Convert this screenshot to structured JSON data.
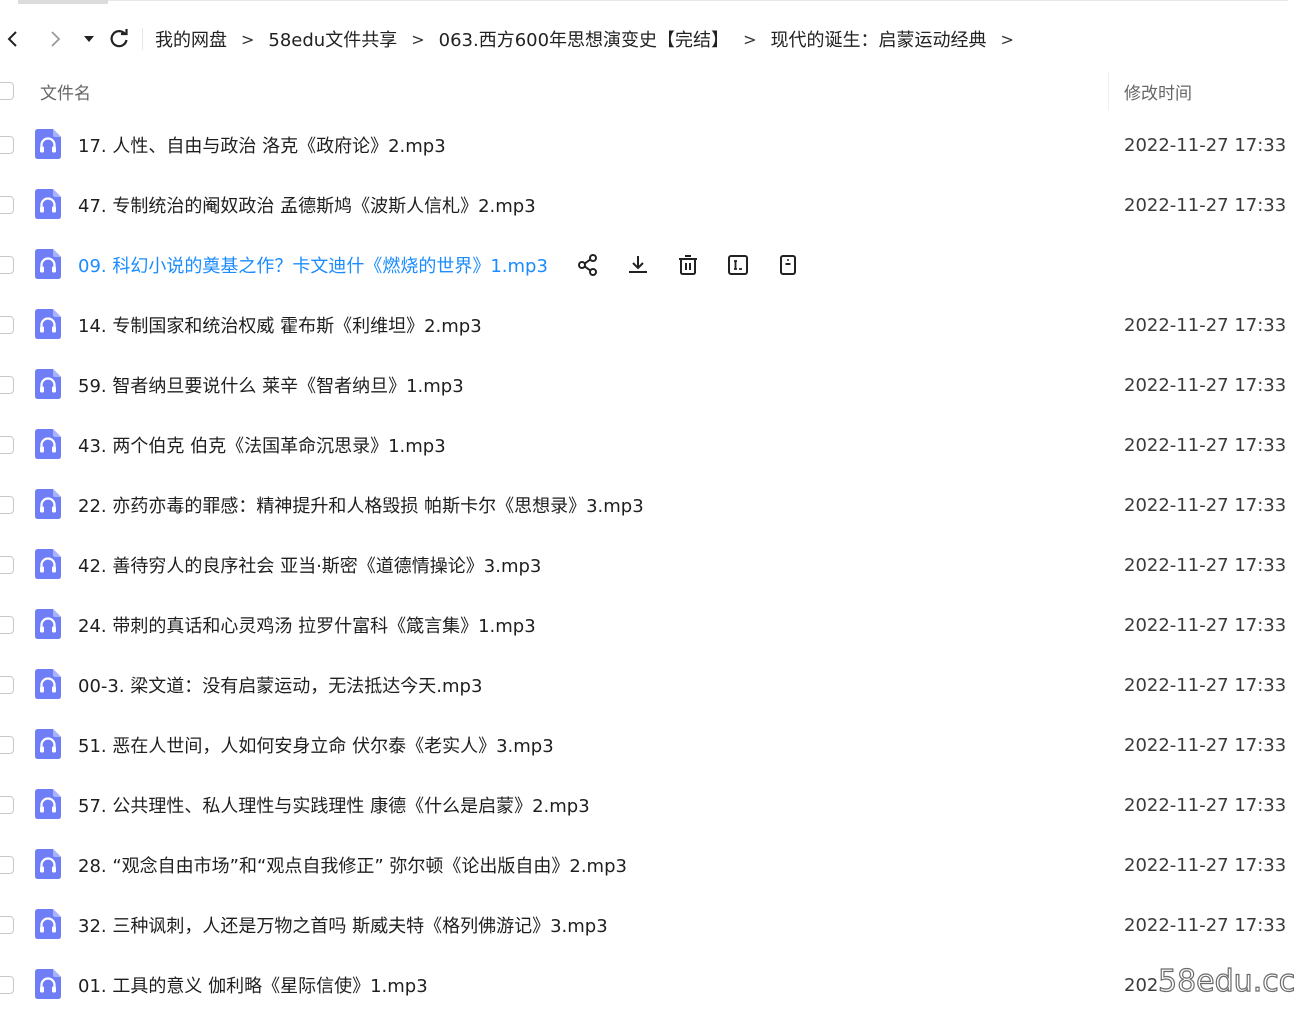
{
  "colors": {
    "accent": "#1a8cff",
    "icon_bg": "#6f7df7",
    "text": "#1f1f1f",
    "muted": "#666666"
  },
  "nav": {
    "back_icon": "chevron-left-icon",
    "forward_icon": "chevron-right-icon",
    "dropdown_icon": "caret-down-icon",
    "refresh_icon": "refresh-icon"
  },
  "breadcrumb": {
    "separator": ">",
    "items": [
      "我的网盘",
      "58edu文件共享",
      "063.西方600年思想演变史【完结】",
      "现代的诞生：启蒙运动经典"
    ]
  },
  "table": {
    "columns": {
      "name": "文件名",
      "modified": "修改时间"
    },
    "rows": [
      {
        "name": "17. 人性、自由与政治 洛克《政府论》2.mp3",
        "modified": "2022-11-27 17:33"
      },
      {
        "name": "47. 专制统治的阉奴政治 孟德斯鸠《波斯人信札》2.mp3",
        "modified": "2022-11-27 17:33"
      },
      {
        "name": "09. 科幻小说的奠基之作？卡文迪什《燃烧的世界》1.mp3",
        "modified": ""
      },
      {
        "name": "14. 专制国家和统治权威 霍布斯《利维坦》2.mp3",
        "modified": "2022-11-27 17:33"
      },
      {
        "name": "59. 智者纳旦要说什么  莱辛《智者纳旦》1.mp3",
        "modified": "2022-11-27 17:33"
      },
      {
        "name": "43. 两个伯克 伯克《法国革命沉思录》1.mp3",
        "modified": "2022-11-27 17:33"
      },
      {
        "name": "22. 亦药亦毒的罪感：精神提升和人格毁损 帕斯卡尔《思想录》3.mp3",
        "modified": "2022-11-27 17:33"
      },
      {
        "name": "42. 善待穷人的良序社会 亚当·斯密《道德情操论》3.mp3",
        "modified": "2022-11-27 17:33"
      },
      {
        "name": "24. 带刺的真话和心灵鸡汤 拉罗什富科《箴言集》1.mp3",
        "modified": "2022-11-27 17:33"
      },
      {
        "name": "00-3. 梁文道：没有启蒙运动，无法抵达今天.mp3",
        "modified": "2022-11-27 17:33"
      },
      {
        "name": "51. 恶在人世间，人如何安身立命 伏尔泰《老实人》3.mp3",
        "modified": "2022-11-27 17:33"
      },
      {
        "name": "57. 公共理性、私人理性与实践理性 康德《什么是启蒙》2.mp3",
        "modified": "2022-11-27 17:33"
      },
      {
        "name": "28. “观念自由市场”和“观点自我修正” 弥尔顿《论出版自由》2.mp3",
        "modified": "2022-11-27 17:33"
      },
      {
        "name": "32. 三种讽刺，人还是万物之首吗 斯威夫特《格列佛游记》3.mp3",
        "modified": "2022-11-27 17:33"
      },
      {
        "name": "01. 工具的意义 伽利略《星际信使》1.mp3",
        "modified": "202"
      }
    ],
    "hover_row_index": 2,
    "row_actions": [
      "share-icon",
      "download-icon",
      "delete-icon",
      "rename-icon",
      "more-icon"
    ]
  },
  "watermark": "58edu.cc"
}
